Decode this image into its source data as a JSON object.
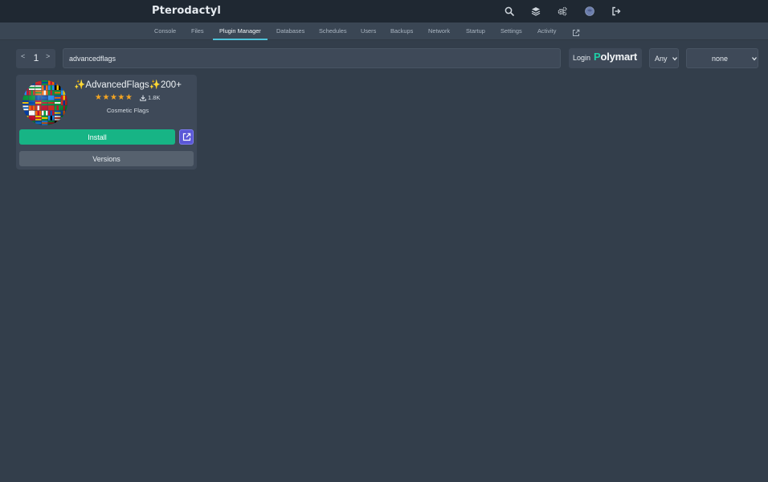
{
  "app": {
    "title": "Pterodactyl"
  },
  "topbar": {
    "icons": [
      "search-icon",
      "layers-icon",
      "cogs-icon",
      "avatar",
      "sign-out-icon"
    ]
  },
  "subnav": {
    "tabs": [
      {
        "label": "Console"
      },
      {
        "label": "Files"
      },
      {
        "label": "Plugin Manager",
        "active": true
      },
      {
        "label": "Databases"
      },
      {
        "label": "Schedules"
      },
      {
        "label": "Users"
      },
      {
        "label": "Backups"
      },
      {
        "label": "Network"
      },
      {
        "label": "Startup"
      },
      {
        "label": "Settings"
      },
      {
        "label": "Activity"
      }
    ],
    "external_icon": "external-link-icon"
  },
  "toolbar": {
    "pager": {
      "prev": "<",
      "page": "1",
      "next": ">"
    },
    "search": {
      "value": "advancedflags"
    },
    "login": {
      "label": "Login",
      "logo_first": "P",
      "logo_rest": "olymart"
    },
    "version_filter": {
      "value": "Any"
    },
    "sort_filter": {
      "value": "none"
    }
  },
  "results": [
    {
      "title": "✨AdvancedFlags✨200+",
      "rating": 5,
      "downloads": "1.8K",
      "category": "Cosmetic Flags",
      "install_label": "Install",
      "versions_label": "Versions"
    }
  ],
  "colors": {
    "background": "#333e4b",
    "topbar": "#1f2832",
    "accent_tab": "#4fc2d8",
    "install": "#17b485",
    "external": "#5a57d6",
    "star": "#f5a623",
    "polymart_p": "#1fd1a7"
  }
}
